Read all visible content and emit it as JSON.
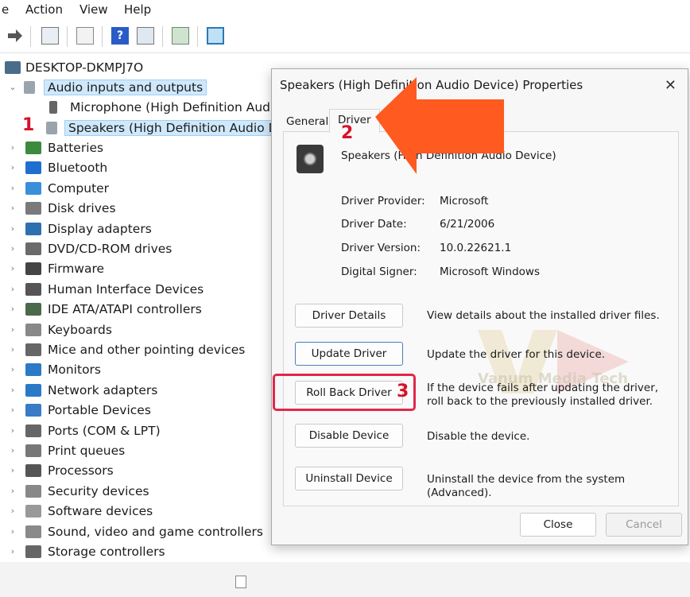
{
  "menu": [
    "e",
    "Action",
    "View",
    "Help"
  ],
  "toolbar_icons": [
    "back-icon",
    "forward-icon",
    "properties-icon",
    "show-hide-icon",
    "help-icon",
    "properties-sheet-icon",
    "update-driver-icon",
    "scan-hardware-icon"
  ],
  "tree": {
    "root": "DESKTOP-DKMPJ7O",
    "expanded_category": "Audio inputs and outputs",
    "children": [
      "Microphone (High Definition Audio",
      "Speakers (High Definition Audio De"
    ],
    "categories": [
      "Batteries",
      "Bluetooth",
      "Computer",
      "Disk drives",
      "Display adapters",
      "DVD/CD-ROM drives",
      "Firmware",
      "Human Interface Devices",
      "IDE ATA/ATAPI controllers",
      "Keyboards",
      "Mice and other pointing devices",
      "Monitors",
      "Network adapters",
      "Portable Devices",
      "Ports (COM & LPT)",
      "Print queues",
      "Processors",
      "Security devices",
      "Software devices",
      "Sound, video and game controllers",
      "Storage controllers"
    ]
  },
  "steps": {
    "one": "1",
    "two": "2",
    "three": "3"
  },
  "dialog": {
    "title": "Speakers (High Definition Audio Device) Properties",
    "close_glyph": "✕",
    "tabs": [
      "General",
      "Driver"
    ],
    "device_name": "Speakers (High Definition Audio Device)",
    "info": [
      {
        "label": "Driver Provider:",
        "value": "Microsoft"
      },
      {
        "label": "Driver Date:",
        "value": "6/21/2006"
      },
      {
        "label": "Driver Version:",
        "value": "10.0.22621.1"
      },
      {
        "label": "Digital Signer:",
        "value": "Microsoft Windows"
      }
    ],
    "actions": [
      {
        "button": "Driver Details",
        "desc": "View details about the installed driver files."
      },
      {
        "button": "Update Driver",
        "desc": "Update the driver for this device."
      },
      {
        "button": "Roll Back Driver",
        "desc": "If the device fails after updating the driver, roll back to the previously installed driver."
      },
      {
        "button": "Disable Device",
        "desc": "Disable the device."
      },
      {
        "button": "Uninstall Device",
        "desc": "Uninstall the device from the system (Advanced)."
      }
    ],
    "close_button": "Close",
    "cancel_button": "Cancel"
  },
  "watermark": {
    "text": "Vanum Media Tech"
  },
  "colors": {
    "arrow": "#ff5a1f",
    "highlight_box": "#e0284a",
    "step_number": "#d8102a",
    "selection": "#cfe8fb"
  }
}
